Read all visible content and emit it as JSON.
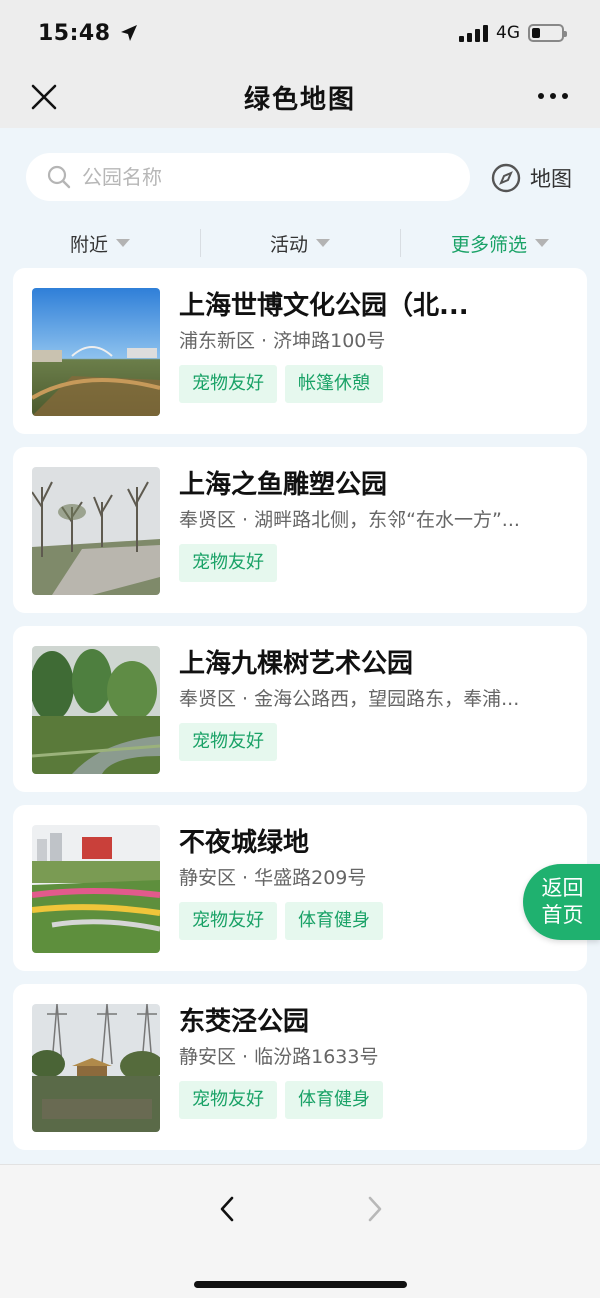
{
  "status_bar": {
    "time": "15:48",
    "network": "4G",
    "battery_level": 0.3
  },
  "nav": {
    "title": "绿色地图"
  },
  "search": {
    "placeholder": "公园名称",
    "value": ""
  },
  "map_button": {
    "label": "地图"
  },
  "filters": [
    {
      "label": "附近",
      "active": false
    },
    {
      "label": "活动",
      "active": false
    },
    {
      "label": "更多筛选",
      "active": true
    }
  ],
  "parks": [
    {
      "name": "上海世博文化公园（北...",
      "address": "浦东新区 · 济坤路100号",
      "tags": [
        "宠物友好",
        "帐篷休憩"
      ]
    },
    {
      "name": "上海之鱼雕塑公园",
      "address": "奉贤区 · 湖畔路北侧，东邻“在水一方”...",
      "tags": [
        "宠物友好"
      ]
    },
    {
      "name": "上海九棵树艺术公园",
      "address": "奉贤区 · 金海公路西，望园路东，奉浦...",
      "tags": [
        "宠物友好"
      ]
    },
    {
      "name": "不夜城绿地",
      "address": "静安区 · 华盛路209号",
      "tags": [
        "宠物友好",
        "体育健身"
      ]
    },
    {
      "name": "东茭泾公园",
      "address": "静安区 · 临汾路1633号",
      "tags": [
        "宠物友好",
        "体育健身"
      ]
    }
  ],
  "home_button": {
    "line1": "返回",
    "line2": "首页"
  },
  "colors": {
    "accent": "#1aa267",
    "tag_bg": "#e6f8ee",
    "fab": "#1fb16f"
  },
  "icons": {
    "close": "close-icon",
    "more": "more-icon",
    "search": "search-icon",
    "compass": "compass-icon",
    "back": "back-arrow-icon",
    "forward": "forward-arrow-icon",
    "location": "location-arrow-icon"
  }
}
